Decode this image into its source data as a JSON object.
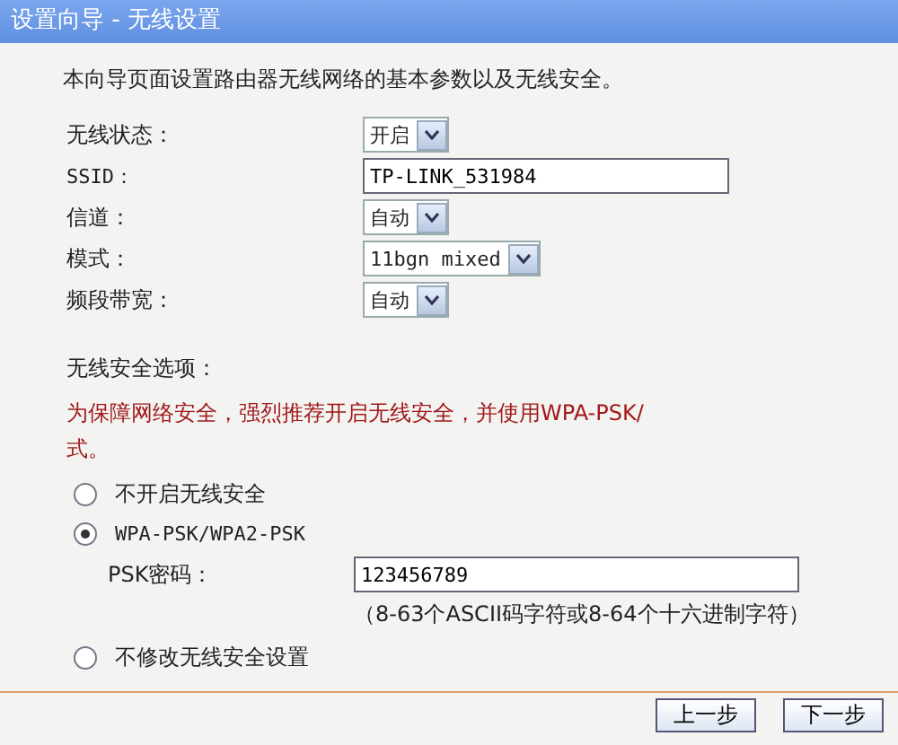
{
  "window": {
    "title": "设置向导 - 无线设置"
  },
  "intro": "本向导页面设置路由器无线网络的基本参数以及无线安全。",
  "fields": [
    {
      "label": "无线状态：",
      "kind": "select",
      "value": "开启"
    },
    {
      "label": "SSID：",
      "kind": "text",
      "value": "TP-LINK_531984"
    },
    {
      "label": "信道：",
      "kind": "select",
      "value": "自动"
    },
    {
      "label": "模式：",
      "kind": "select",
      "value": "11bgn mixed"
    },
    {
      "label": "频段带宽：",
      "kind": "select",
      "value": "自动"
    }
  ],
  "security": {
    "heading": "无线安全选项：",
    "warning_lines": [
      "为保障网络安全，强烈推荐开启无线安全，并使用WPA-PSK/",
      "式。"
    ],
    "options": [
      {
        "label": "不开启无线安全",
        "selected": false
      },
      {
        "label": "WPA-PSK/WPA2-PSK",
        "selected": true,
        "psk_label": "PSK密码：",
        "psk_value": "123456789",
        "hint": "（8-63个ASCII码字符或8-64个十六进制字符）"
      },
      {
        "label": "不修改无线安全设置",
        "selected": false
      }
    ]
  },
  "buttons": [
    "上一步",
    "下一步"
  ]
}
